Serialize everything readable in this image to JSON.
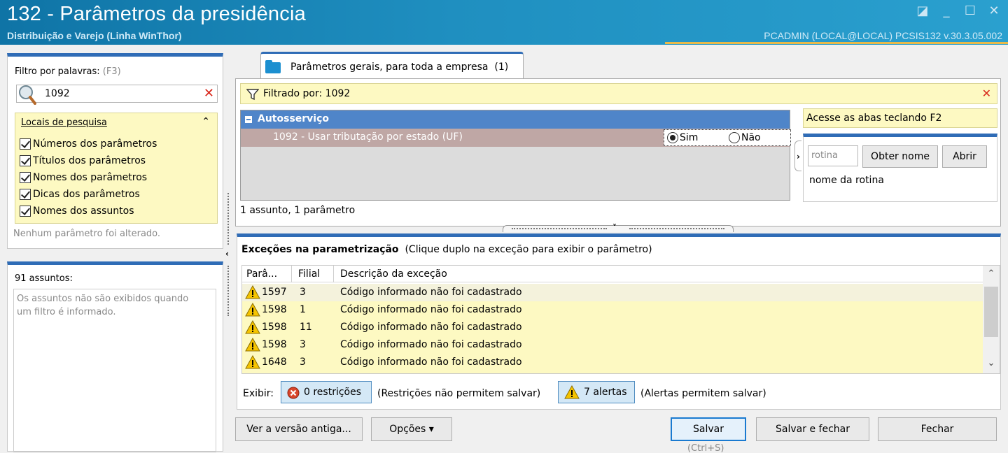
{
  "window": {
    "title": "132 - Parâmetros da presidência",
    "subtitle": "Distribuição e Varejo (Linha WinThor)",
    "user_info": "PCADMIN (LOCAL@LOCAL)  PCSIS132  v.30.3.05.002",
    "controls": {
      "minimize": "_",
      "maximize": "☐",
      "close": "✕",
      "restore": "◪"
    }
  },
  "filter_panel": {
    "label": "Filtro por palavras:",
    "shortcut": "(F3)",
    "search_value": "1092",
    "locais_header": "Locais de pesquisa",
    "checkboxes": [
      {
        "label": "Números dos parâmetros",
        "checked": true
      },
      {
        "label": "Títulos dos parâmetros",
        "checked": true
      },
      {
        "label": "Nomes dos parâmetros",
        "checked": true
      },
      {
        "label": "Dicas dos parâmetros",
        "checked": true
      },
      {
        "label": "Nomes dos assuntos",
        "checked": true
      }
    ],
    "status": "Nenhum parâmetro foi alterado."
  },
  "subjects_panel": {
    "label": "91 assuntos:",
    "message_line1": "Os assuntos não são exibidos quando",
    "message_line2": "um filtro é informado."
  },
  "tab": {
    "label": "Parâmetros gerais, para toda a empresa",
    "count": "(1)"
  },
  "filter_bar": {
    "text": "Filtrado por: 1092"
  },
  "grid": {
    "group": "Autosserviço",
    "row": {
      "label": "1092 - Usar tributação por estado (UF)",
      "option_yes": "Sim",
      "option_no": "Não",
      "selected": "Sim"
    },
    "count": "1 assunto, 1 parâmetro"
  },
  "side": {
    "access_hint": "Acesse as abas teclando F2",
    "routine_placeholder": "rotina",
    "get_name_button": "Obter nome",
    "open_button": "Abrir",
    "routine_name": "nome da rotina"
  },
  "exceptions": {
    "title": "Exceções na parametrização",
    "subtitle": "(Clique duplo na exceção para exibir o parâmetro)",
    "columns": [
      "Parâ...",
      "Filial",
      "Descrição da exceção"
    ],
    "rows": [
      {
        "param": "1597",
        "filial": "3",
        "desc": "Código informado não foi cadastrado"
      },
      {
        "param": "1598",
        "filial": "1",
        "desc": "Código informado não foi cadastrado"
      },
      {
        "param": "1598",
        "filial": "11",
        "desc": "Código informado não foi cadastrado"
      },
      {
        "param": "1598",
        "filial": "3",
        "desc": "Código informado não foi cadastrado"
      },
      {
        "param": "1648",
        "filial": "3",
        "desc": "Código informado não foi cadastrado"
      }
    ],
    "show_label": "Exibir:",
    "restrictions_button": "0 restrições",
    "restrictions_note": "(Restrições não permitem salvar)",
    "alerts_button": "7 alertas",
    "alerts_note": "(Alertas permitem salvar)"
  },
  "footer": {
    "old_version": "Ver a versão antiga...",
    "options": "Opções",
    "save": "Salvar",
    "save_shortcut": "(Ctrl+S)",
    "save_close": "Salvar e fechar",
    "close": "Fechar"
  },
  "colors": {
    "accent": "#2f6cb6",
    "highlight": "#fdf9c2",
    "titlebar": "#1f8fc0",
    "error": "#d8261a"
  }
}
